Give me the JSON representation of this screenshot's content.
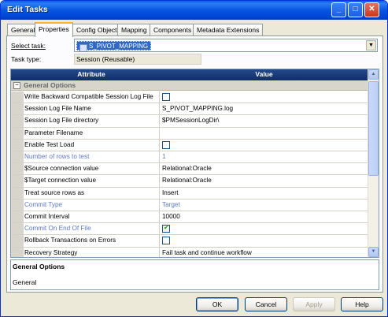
{
  "window": {
    "title": "Edit Tasks",
    "controls": {
      "minimize": "_",
      "maximize": "□",
      "close": "✕"
    }
  },
  "tabs": [
    {
      "label": "General"
    },
    {
      "label": "Properties"
    },
    {
      "label": "Config Object"
    },
    {
      "label": "Mapping"
    },
    {
      "label": "Components"
    },
    {
      "label": "Metadata Extensions"
    }
  ],
  "form": {
    "select_task_label": "Select task:",
    "select_task_value": "S_PIVOT_MAPPING",
    "task_type_label": "Task type:",
    "task_type_value": "Session (Reusable)"
  },
  "grid": {
    "header_attribute": "Attribute",
    "header_value": "Value",
    "section_expander": "−",
    "section_title": "General Options",
    "rows": [
      {
        "attribute": "Write Backward Compatible Session Log File",
        "value": "",
        "type": "checkbox",
        "checked": false,
        "disabled": false
      },
      {
        "attribute": "Session Log File Name",
        "value": "S_PIVOT_MAPPING.log",
        "type": "text",
        "disabled": false
      },
      {
        "attribute": "Session Log File directory",
        "value": "$PMSessionLogDir\\",
        "type": "text",
        "disabled": false
      },
      {
        "attribute": "Parameter Filename",
        "value": "",
        "type": "text",
        "disabled": false
      },
      {
        "attribute": "Enable Test Load",
        "value": "",
        "type": "checkbox",
        "checked": false,
        "disabled": false
      },
      {
        "attribute": "Number of rows to test",
        "value": "1",
        "type": "text",
        "disabled": true
      },
      {
        "attribute": "$Source connection value",
        "value": "Relational:Oracle",
        "type": "text",
        "disabled": false
      },
      {
        "attribute": "$Target connection value",
        "value": "Relational:Oracle",
        "type": "text",
        "disabled": false
      },
      {
        "attribute": "Treat source rows as",
        "value": "Insert",
        "type": "text",
        "disabled": false
      },
      {
        "attribute": "Commit Type",
        "value": "Target",
        "type": "text",
        "disabled": true
      },
      {
        "attribute": "Commit Interval",
        "value": "10000",
        "type": "text",
        "disabled": false
      },
      {
        "attribute": "Commit On End Of File",
        "value": "",
        "type": "checkbox",
        "checked": true,
        "disabled": true
      },
      {
        "attribute": "Rollback Transactions on Errors",
        "value": "",
        "type": "checkbox",
        "checked": false,
        "disabled": false
      },
      {
        "attribute": "Recovery Strategy",
        "value": "Fail task and continue workflow",
        "type": "text",
        "disabled": false
      }
    ]
  },
  "description": {
    "title": "General Options",
    "text": "General"
  },
  "buttons": {
    "ok": "OK",
    "cancel": "Cancel",
    "apply": "Apply",
    "help": "Help"
  },
  "scrollbar": {
    "up": "▲",
    "down": "▼"
  }
}
